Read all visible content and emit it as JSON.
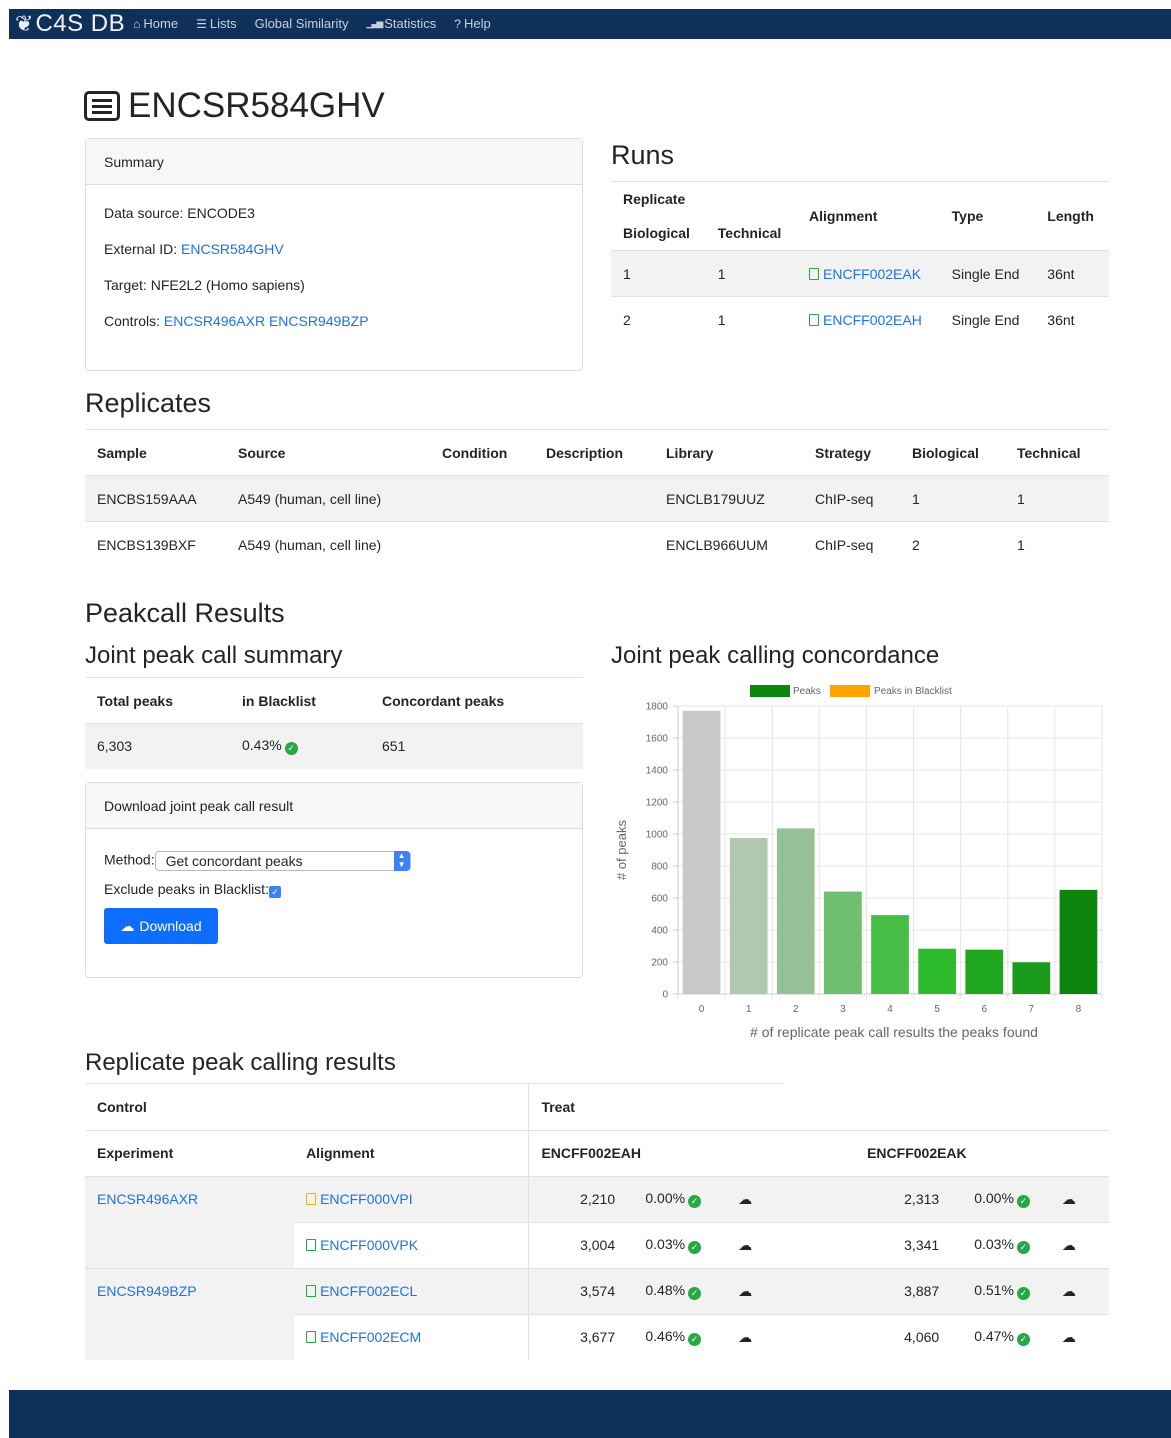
{
  "nav": {
    "brand": "C4S DB",
    "items": [
      {
        "icon": "home-icon",
        "glyph": "⌂",
        "label": "Home"
      },
      {
        "icon": "list-icon",
        "glyph": "☰",
        "label": "Lists"
      },
      {
        "icon": "",
        "glyph": "",
        "label": "Global Similarity"
      },
      {
        "icon": "bar-chart-icon",
        "glyph": "▁▃▅",
        "label": "Statistics"
      },
      {
        "icon": "help-icon",
        "glyph": "?",
        "label": "Help"
      }
    ]
  },
  "page": {
    "title": "ENCSR584GHV"
  },
  "summary": {
    "header": "Summary",
    "data_source_label": "Data source:",
    "data_source": "ENCODE3",
    "external_id_label": "External ID:",
    "external_id": "ENCSR584GHV",
    "target_label": "Target:",
    "target": "NFE2L2 (Homo sapiens)",
    "controls_label": "Controls:",
    "controls": [
      "ENCSR496AXR",
      "ENCSR949BZP"
    ]
  },
  "runs": {
    "heading": "Runs",
    "headers": {
      "replicate": "Replicate",
      "biological": "Biological",
      "technical": "Technical",
      "alignment": "Alignment",
      "type": "Type",
      "length": "Length"
    },
    "rows": [
      {
        "biological": "1",
        "technical": "1",
        "alignment": "ENCFF002EAK",
        "type": "Single End",
        "length": "36nt"
      },
      {
        "biological": "2",
        "technical": "1",
        "alignment": "ENCFF002EAH",
        "type": "Single End",
        "length": "36nt"
      }
    ]
  },
  "replicates": {
    "heading": "Replicates",
    "headers": [
      "Sample",
      "Source",
      "Condition",
      "Description",
      "Library",
      "Strategy",
      "Biological",
      "Technical"
    ],
    "rows": [
      [
        "ENCBS159AAA",
        "A549 (human, cell line)",
        "",
        "",
        "ENCLB179UUZ",
        "ChIP-seq",
        "1",
        "1"
      ],
      [
        "ENCBS139BXF",
        "A549 (human, cell line)",
        "",
        "",
        "ENCLB966UUM",
        "ChIP-seq",
        "2",
        "1"
      ]
    ]
  },
  "peakcall": {
    "heading": "Peakcall Results",
    "joint_heading": "Joint peak call summary",
    "joint_headers": [
      "Total peaks",
      "in Blacklist",
      "Concordant peaks"
    ],
    "joint_values": [
      "6,303",
      "0.43%",
      "651"
    ],
    "download": {
      "header": "Download joint peak call result",
      "method_label": "Method:",
      "method_value": "Get concordant peaks",
      "exclude_label": "Exclude peaks in Blacklist:",
      "exclude_checked": true,
      "button_label": "Download"
    },
    "concordance_heading": "Joint peak calling concordance"
  },
  "chart_data": {
    "type": "bar",
    "title": "",
    "categories": [
      "0",
      "1",
      "2",
      "3",
      "4",
      "5",
      "6",
      "7",
      "8"
    ],
    "series": [
      {
        "name": "Peaks",
        "values": [
          1770,
          975,
          1035,
          640,
          493,
          283,
          277,
          198,
          651
        ]
      },
      {
        "name": "Peaks in Blacklist",
        "values": [
          0,
          0,
          0,
          0,
          0,
          0,
          0,
          0,
          0
        ]
      }
    ],
    "bar_colors": [
      "#c8c8c8",
      "#b0c8b0",
      "#96c196",
      "#70be70",
      "#46be46",
      "#2dbb2d",
      "#1fa61f",
      "#1a9a1a",
      "#0b850b"
    ],
    "legend_colors": [
      "#0b850b",
      "#ffa500"
    ],
    "legend_position": "top",
    "xlabel": "# of replicate peak call results the peaks found",
    "ylabel": "# of peaks",
    "ylim": [
      0,
      1800
    ],
    "yticks": [
      0,
      200,
      400,
      600,
      800,
      1000,
      1200,
      1400,
      1600,
      1800
    ],
    "grid": true
  },
  "replicate_results": {
    "heading": "Replicate peak calling results",
    "control_label": "Control",
    "treat_label": "Treat",
    "experiment_label": "Experiment",
    "alignment_label": "Alignment",
    "treat_cols": [
      "ENCFF002EAH",
      "ENCFF002EAK"
    ],
    "rows": [
      {
        "experiment": "ENCSR496AXR",
        "alignment": "ENCFF000VPI",
        "file_color": "yellow",
        "eah_peaks": "2,210",
        "eah_pct": "0.00%",
        "eak_peaks": "2,313",
        "eak_pct": "0.00%"
      },
      {
        "experiment": "",
        "alignment": "ENCFF000VPK",
        "file_color": "green",
        "eah_peaks": "3,004",
        "eah_pct": "0.03%",
        "eak_peaks": "3,341",
        "eak_pct": "0.03%"
      },
      {
        "experiment": "ENCSR949BZP",
        "alignment": "ENCFF002ECL",
        "file_color": "green",
        "eah_peaks": "3,574",
        "eah_pct": "0.48%",
        "eak_peaks": "3,887",
        "eak_pct": "0.51%"
      },
      {
        "experiment": "",
        "alignment": "ENCFF002ECM",
        "file_color": "green",
        "eah_peaks": "3,677",
        "eah_pct": "0.46%",
        "eak_peaks": "4,060",
        "eak_pct": "0.47%"
      }
    ]
  }
}
